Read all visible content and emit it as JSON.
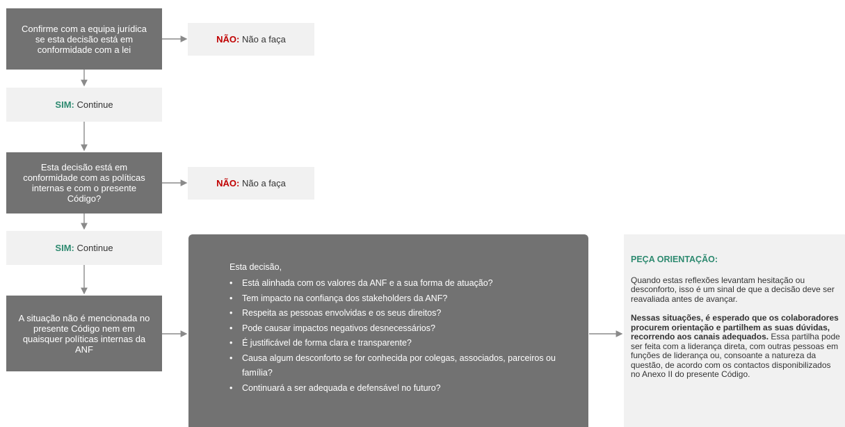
{
  "step1": {
    "text": "Confirme com a equipa jurídica se esta decisão está em conformidade com a lei"
  },
  "no1": {
    "label": "NÃO",
    "sep": ":",
    "text": "Não a faça"
  },
  "yes1": {
    "label": "SIM",
    "sep": ":",
    "text": "Continue"
  },
  "step2": {
    "text": "Esta decisão está em conformidade com as políticas internas e com o presente Código?"
  },
  "no2": {
    "label": "NÃO",
    "sep": ":",
    "text": "Não a faça"
  },
  "yes2": {
    "label": "SIM",
    "sep": ":",
    "text": "Continue"
  },
  "step3": {
    "text": "A situação não é mencionada no presente Código nem em quaisquer políticas internas da ANF"
  },
  "questions": {
    "intro": "Esta decisão,",
    "items": [
      "Está alinhada com os valores da ANF e a sua forma de atuação?",
      "Tem impacto na confiança dos stakeholders da ANF?",
      "Respeita as pessoas envolvidas e os seus direitos?",
      "Pode causar impactos negativos desnecessários?",
      "É justificável de forma clara e transparente?",
      "Causa algum desconforto se for conhecida por colegas, associados, parceiros ou família?",
      "Continuará a ser adequada e defensável no futuro?"
    ]
  },
  "guidance": {
    "title": "PEÇA ORIENTAÇÃO:",
    "para1": "Quando estas reflexões levantam hesitação ou desconforto, isso é um sinal de que a decisão deve ser reavaliada antes de avançar.",
    "para2_bold": "Nessas situações, é esperado que os colaboradores procurem orientação e partilhem as suas dúvidas, recorrendo aos canais adequados.",
    "para2_rest": " Essa partilha pode ser feita com a liderança direta, com outras pessoas em funções de liderança ou, consoante a natureza da questão, de acordo com os contactos disponibilizados no Anexo II do presente Código."
  },
  "colors": {
    "dark_box": "#727272",
    "light_box": "#f1f1f1",
    "no": "#c00000",
    "yes": "#2e8a70",
    "arrow": "#8a8a8a"
  }
}
